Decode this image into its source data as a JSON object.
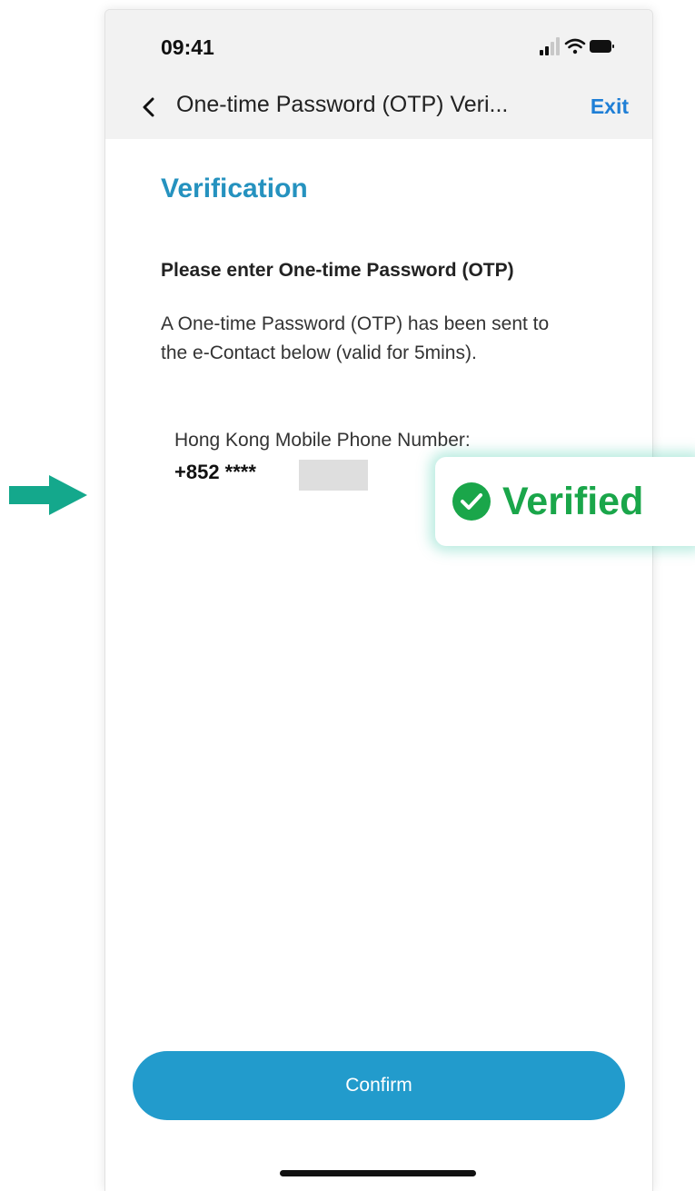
{
  "status_bar": {
    "time": "09:41",
    "icons": [
      "signal-icon",
      "wifi-icon",
      "battery-icon"
    ]
  },
  "nav": {
    "title": "One-time Password (OTP) Veri...",
    "exit_label": "Exit",
    "back_icon": "chevron-left-icon"
  },
  "content": {
    "heading": "Verification",
    "subheading": "Please enter One-time Password (OTP)",
    "description": "A One-time Password (OTP) has been sent to the e-Contact below (valid for 5mins).",
    "phone_label": "Hong Kong Mobile Phone Number:",
    "phone_value": "+852 ****"
  },
  "confirm_label": "Confirm",
  "badge": {
    "label": "Verified",
    "icon": "check-circle-icon"
  },
  "colors": {
    "accent": "#229bcc",
    "heading": "#2592bf",
    "link": "#1f7fd6",
    "verified": "#1aa64a",
    "arrow": "#14a88c"
  }
}
